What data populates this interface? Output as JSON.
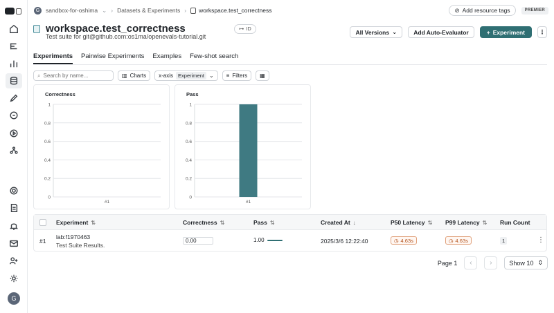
{
  "breadcrumb": {
    "org_initial": "G",
    "org": "sandbox-for-oshima",
    "section": "Datasets & Experiments",
    "current": "workspace.test_correctness"
  },
  "top_actions": {
    "resource_tags": "Add resource tags",
    "plan_badge": "PREMIER"
  },
  "header": {
    "title": "workspace.test_correctness",
    "id_label": "ID",
    "subtitle": "Test suite for git@github.com:os1ma/openevals-tutorial.git",
    "versions": "All Versions",
    "auto_evaluator": "Add Auto-Evaluator",
    "experiment": "Experiment"
  },
  "tabs": [
    "Experiments",
    "Pairwise Experiments",
    "Examples",
    "Few-shot search"
  ],
  "toolbar": {
    "search_placeholder": "Search by name...",
    "charts": "Charts",
    "xaxis_label": "x-axis",
    "xaxis_value": "Experiment",
    "filters": "Filters"
  },
  "chart_data": [
    {
      "type": "bar",
      "title": "Correctness",
      "categories": [
        "#1"
      ],
      "values": [
        0.0
      ],
      "ylim": [
        0,
        1
      ],
      "yticks": [
        "0",
        "0.2",
        "0.4",
        "0.6",
        "0.8",
        "1"
      ],
      "grid": true,
      "color": "#3f7a82"
    },
    {
      "type": "bar",
      "title": "Pass",
      "categories": [
        "#1"
      ],
      "values": [
        1.0
      ],
      "ylim": [
        0,
        1
      ],
      "yticks": [
        "0",
        "0.2",
        "0.4",
        "0.6",
        "0.8",
        "1"
      ],
      "grid": true,
      "color": "#3f7a82"
    }
  ],
  "table": {
    "headers": {
      "experiment": "Experiment",
      "correctness": "Correctness",
      "pass": "Pass",
      "created": "Created At",
      "p50": "P50 Latency",
      "p99": "P99 Latency",
      "runs": "Run Count"
    },
    "rows": [
      {
        "index": "#1",
        "name": "lab:f1970463",
        "description": "Test Suite Results.",
        "correctness": "0.00",
        "pass": "1.00",
        "pass_fraction": 1.0,
        "created": "2025/3/6 12:22:40",
        "p50": "4.63s",
        "p99": "4.63s",
        "runs": "1"
      }
    ]
  },
  "pagination": {
    "page": "Page 1",
    "show": "Show 10"
  }
}
